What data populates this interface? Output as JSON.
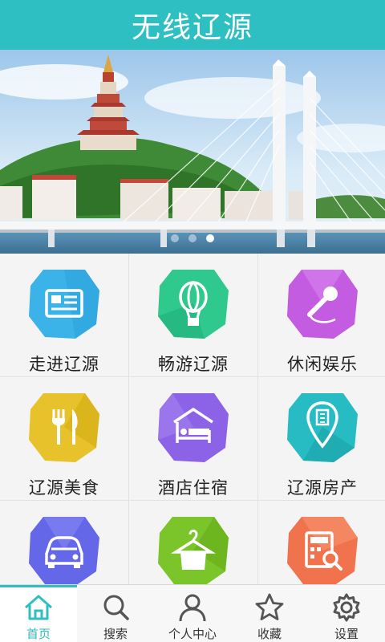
{
  "app": {
    "title": "无线辽源"
  },
  "banner": {
    "slides": 3,
    "active_slide": 3
  },
  "grid": {
    "items": [
      {
        "label": "走进辽源",
        "icon": "newspaper-icon",
        "color": "#3bb3e9"
      },
      {
        "label": "畅游辽源",
        "icon": "hot-air-balloon-icon",
        "color": "#2fc98e"
      },
      {
        "label": "休闲娱乐",
        "icon": "microphone-icon",
        "color": "#c35ce0"
      },
      {
        "label": "辽源美食",
        "icon": "fork-knife-icon",
        "color": "#e7c22a"
      },
      {
        "label": "酒店住宿",
        "icon": "bed-icon",
        "color": "#8c63e6"
      },
      {
        "label": "辽源房产",
        "icon": "location-building-icon",
        "color": "#27bcc3"
      },
      {
        "label": "",
        "icon": "car-icon",
        "color": "#6467e8"
      },
      {
        "label": "",
        "icon": "hanger-icon",
        "color": "#7bc52b"
      },
      {
        "label": "",
        "icon": "calculator-search-icon",
        "color": "#f0734d"
      }
    ]
  },
  "tabbar": {
    "accent": "#2dbfc2",
    "active_index": 0,
    "items": [
      {
        "label": "首页",
        "icon": "home-icon"
      },
      {
        "label": "搜索",
        "icon": "search-icon"
      },
      {
        "label": "个人中心",
        "icon": "user-icon"
      },
      {
        "label": "收藏",
        "icon": "star-icon"
      },
      {
        "label": "设置",
        "icon": "gear-icon"
      }
    ]
  }
}
